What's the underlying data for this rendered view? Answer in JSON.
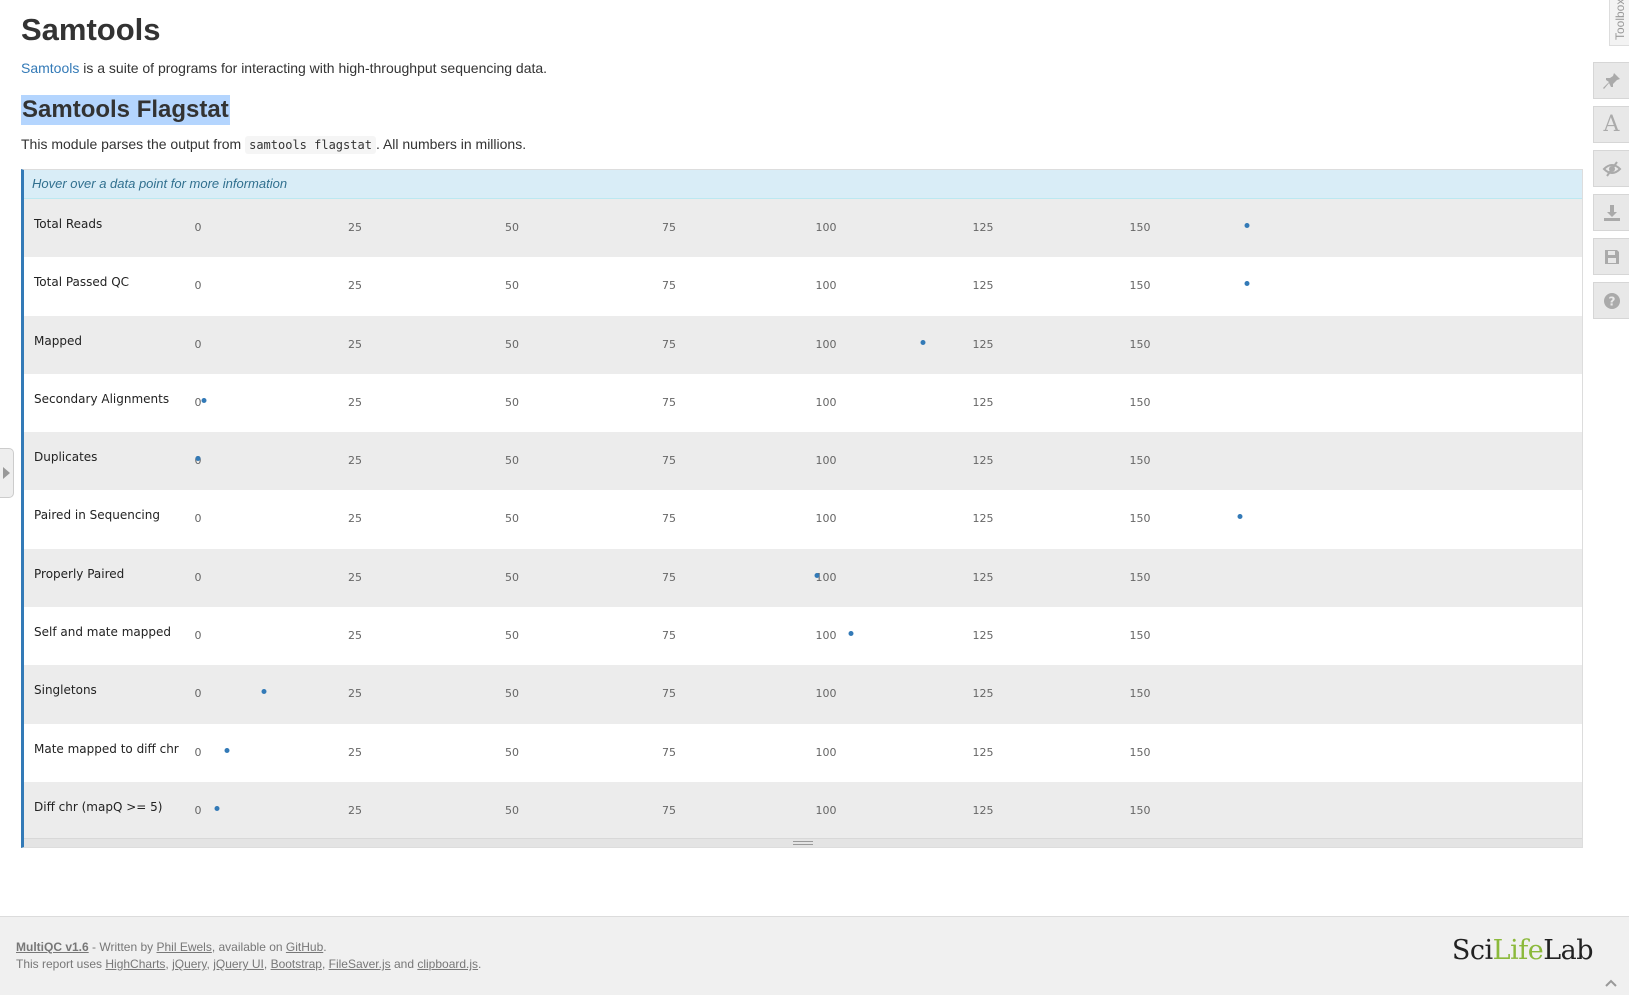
{
  "page": {
    "title": "Samtools",
    "intro_link": "Samtools",
    "intro_rest": " is a suite of programs for interacting with high-throughput sequencing data.",
    "section_title": "Samtools Flagstat",
    "desc_before": "This module parses the output from ",
    "desc_code": "samtools flagstat",
    "desc_after": ". All numbers in millions."
  },
  "plot": {
    "hover_hint": "Hover over a data point for more information",
    "dot_color": "#337ab7"
  },
  "chart_data": {
    "type": "scatter",
    "xlim": [
      0,
      160
    ],
    "ticks": [
      "0",
      "25",
      "50",
      "75",
      "100",
      "125",
      "150"
    ],
    "tick_values": [
      0,
      25,
      50,
      75,
      100,
      125,
      150
    ],
    "rows": [
      {
        "label": "Total Reads",
        "value": 167
      },
      {
        "label": "Total Passed QC",
        "value": 167
      },
      {
        "label": "Mapped",
        "value": 115.5
      },
      {
        "label": "Secondary Alignments",
        "value": 1
      },
      {
        "label": "Duplicates",
        "value": 0
      },
      {
        "label": "Paired in Sequencing",
        "value": 166
      },
      {
        "label": "Properly Paired",
        "value": 98.5
      },
      {
        "label": "Self and mate mapped",
        "value": 104
      },
      {
        "label": "Singletons",
        "value": 10.5
      },
      {
        "label": "Mate mapped to diff chr",
        "value": 4.6
      },
      {
        "label": "Diff chr (mapQ >= 5)",
        "value": 3.1
      }
    ]
  },
  "toolbox": {
    "tab_label": "Toolbox",
    "buttons": [
      "pin-icon",
      "font-icon",
      "eye-icon",
      "download-icon",
      "save-icon",
      "help-icon"
    ]
  },
  "footer": {
    "multiqc": "MultiQC v1.6",
    "written_by": " - Written by ",
    "author": "Phil Ewels",
    "available_on": ", available on ",
    "github": "GitHub",
    "period": ".",
    "uses": "This report uses ",
    "lib1": "HighCharts",
    "lib2": "jQuery",
    "lib3": "jQuery UI",
    "lib4": "Bootstrap",
    "lib5": "FileSaver.js",
    "and": " and ",
    "lib6": "clipboard.js",
    "comma": ", ",
    "logo_sci": "Sci",
    "logo_life": "Life",
    "logo_lab": "Lab"
  }
}
